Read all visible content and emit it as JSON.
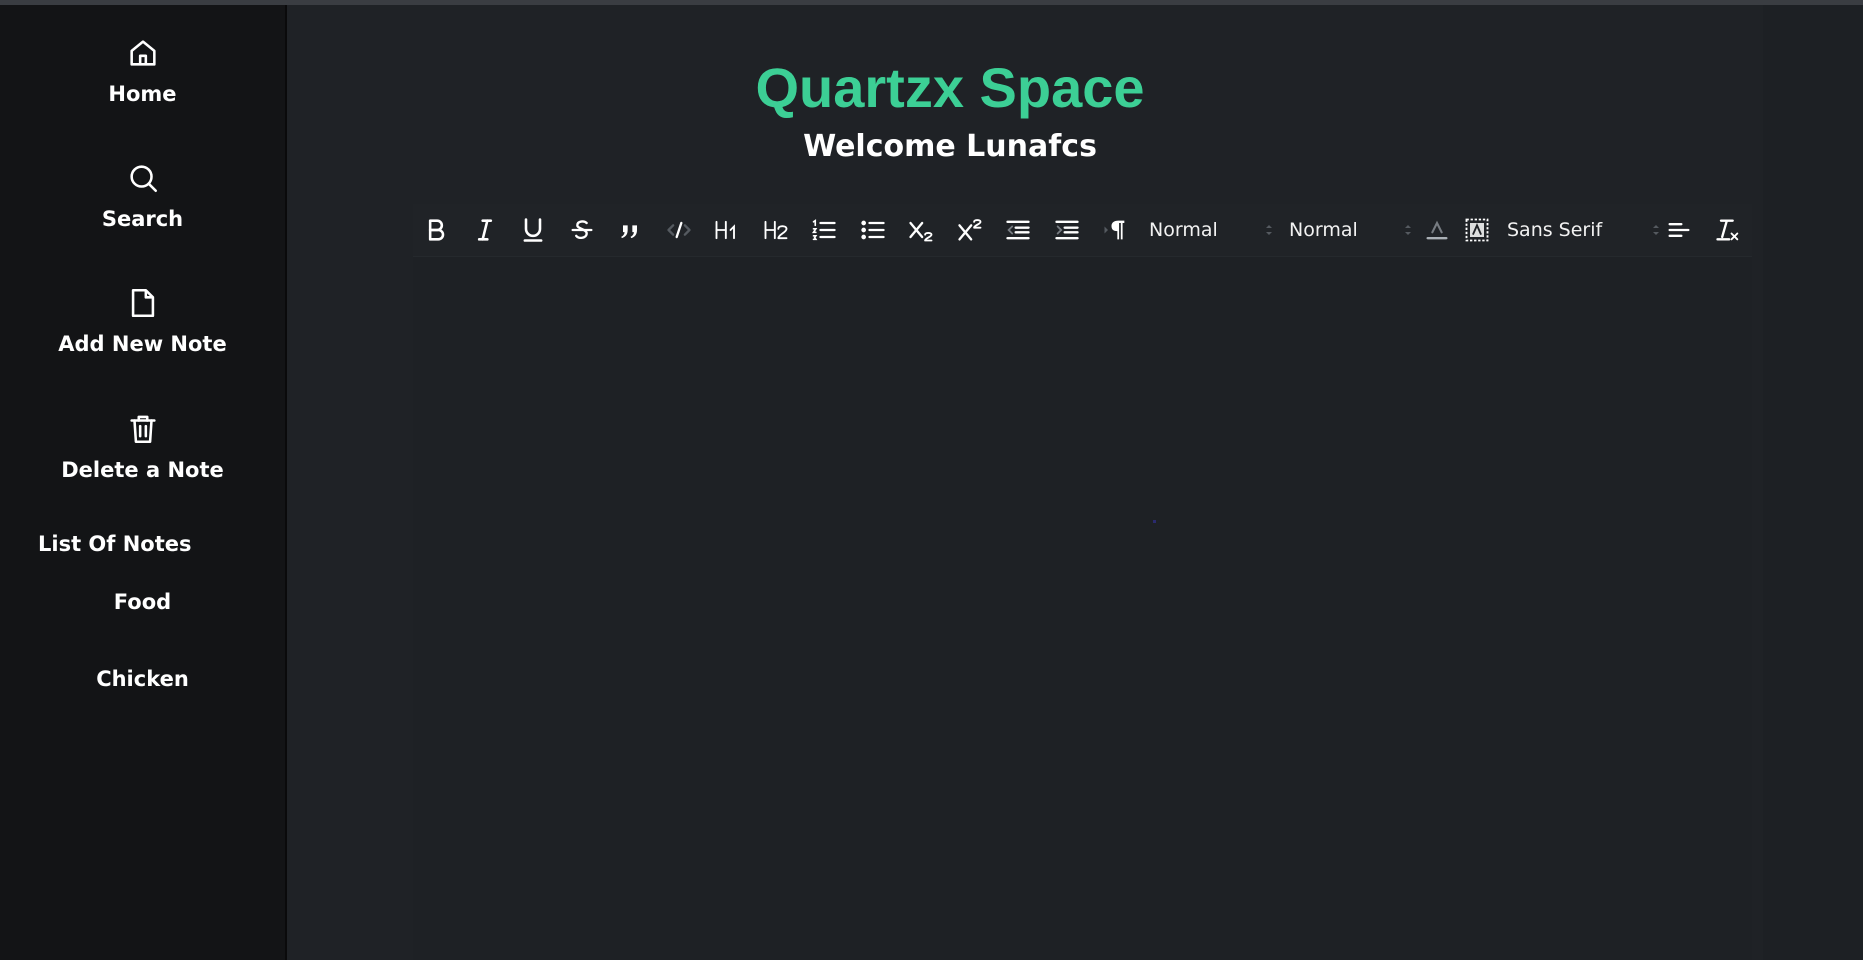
{
  "sidebar": {
    "items": [
      {
        "label": "Home",
        "icon": "home-icon"
      },
      {
        "label": "Search",
        "icon": "search-icon"
      },
      {
        "label": "Add New Note",
        "icon": "file-icon"
      },
      {
        "label": "Delete a Note",
        "icon": "trash-icon"
      }
    ],
    "list_heading": "List Of Notes",
    "notes": [
      "Food",
      "Chicken"
    ]
  },
  "header": {
    "title": "Quartzx Space",
    "welcome": "Welcome Lunafcs"
  },
  "toolbar": {
    "header_select": "Normal",
    "size_select": "Normal",
    "font_select": "Sans Serif",
    "buttons": [
      "bold-icon",
      "italic-icon",
      "underline-icon",
      "strike-icon",
      "blockquote-icon",
      "code-icon",
      "h1-icon",
      "h2-icon",
      "ordered-list-icon",
      "bullet-list-icon",
      "subscript-icon",
      "superscript-icon",
      "outdent-icon",
      "indent-icon",
      "direction-icon",
      "color-icon",
      "background-icon",
      "align-icon",
      "clean-icon"
    ]
  },
  "colors": {
    "accent": "#3ccf95",
    "sidebar_bg": "#131416",
    "main_bg": "#1f2226"
  }
}
